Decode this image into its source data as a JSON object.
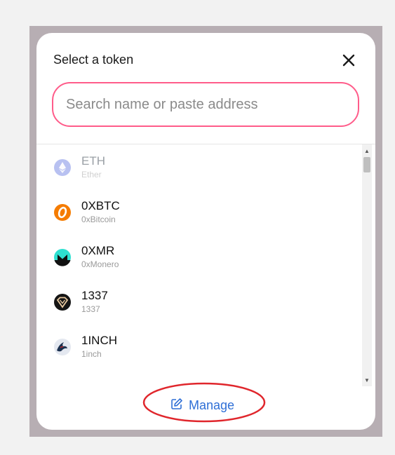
{
  "modal": {
    "title": "Select a token",
    "close_icon": "close-icon",
    "search": {
      "placeholder": "Search name or paste address",
      "value": ""
    },
    "tokens": [
      {
        "symbol": "ETH",
        "name": "Ether",
        "icon": "ethereum-icon",
        "faded": true
      },
      {
        "symbol": "0XBTC",
        "name": "0xBitcoin",
        "icon": "0xbitcoin-icon"
      },
      {
        "symbol": "0XMR",
        "name": "0xMonero",
        "icon": "0xmonero-icon"
      },
      {
        "symbol": "1337",
        "name": "1337",
        "icon": "1337-icon"
      },
      {
        "symbol": "1INCH",
        "name": "1inch",
        "icon": "1inch-icon"
      }
    ],
    "manage": {
      "label": "Manage",
      "icon": "edit-icon"
    },
    "annotation": {
      "shape": "ellipse",
      "color": "#e0262c"
    }
  },
  "colors": {
    "search_border": "#ff5c8a",
    "manage_link": "#2f6fd6",
    "backdrop": "#b7aeb3"
  }
}
